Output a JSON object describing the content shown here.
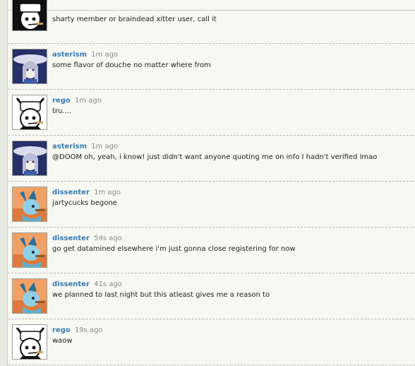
{
  "messages": [
    {
      "user": "",
      "time": "",
      "text": "sharty member or braindead xitter user, call it",
      "avatar_icon": "gray-bunny-avatar"
    },
    {
      "user": "asterism",
      "time": "1m ago",
      "text": "some flavor of douche no matter where from",
      "avatar_icon": "anime-witch-avatar"
    },
    {
      "user": "rego",
      "time": "1m ago",
      "text": "tru....",
      "avatar_icon": "gray-bunny-avatar"
    },
    {
      "user": "asterism",
      "time": "1m ago",
      "text": "@DOOM oh, yeah, i know! just didn't want anyone quoting me on info I hadn't verified lmao",
      "avatar_icon": "anime-witch-avatar"
    },
    {
      "user": "dissenter",
      "time": "1m ago",
      "text": "jartycucks begone",
      "avatar_icon": "glaceon-cigar-avatar"
    },
    {
      "user": "dissenter",
      "time": "54s ago",
      "text": "go get datamined elsewhere i'm just gonna close registering for now",
      "avatar_icon": "glaceon-cigar-avatar"
    },
    {
      "user": "dissenter",
      "time": "41s ago",
      "text": "we planned to last night but this atleast gives me a reason to",
      "avatar_icon": "glaceon-cigar-avatar"
    },
    {
      "user": "rego",
      "time": "19s ago",
      "text": "waow",
      "avatar_icon": "gray-bunny-avatar"
    }
  ],
  "colors": {
    "username": "#3a7ab8",
    "timestamp": "#8a8d87",
    "background": "#f6f8f1"
  }
}
